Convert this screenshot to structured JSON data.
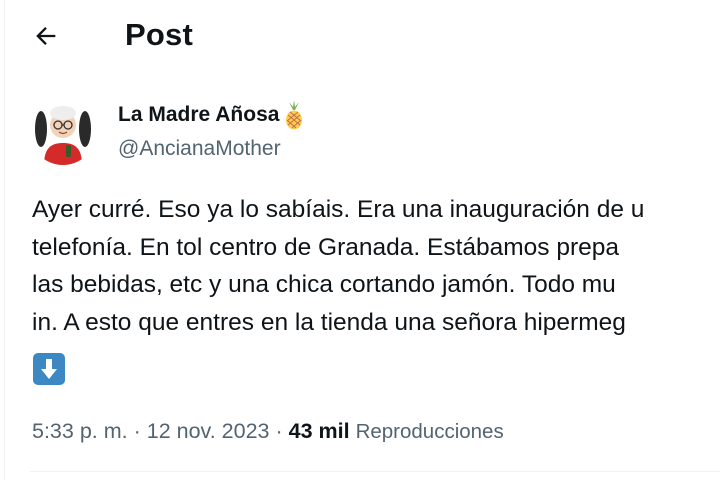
{
  "header": {
    "back_icon": "arrow-left-icon",
    "title": "Post"
  },
  "author": {
    "name": "La Madre Añosa",
    "name_emoji": "pineapple-icon",
    "handle": "@AncianaMother",
    "avatar": "cartoon-grandmother-avatar"
  },
  "tweet": {
    "lines": [
      "Ayer curré. Eso ya lo sabíais. Era una inauguración de u",
      "telefonía. En tol centro de Granada. Estábamos prepa",
      "las bebidas, etc y una chica cortando jamón. Todo mu",
      "in. A esto que entres en la tienda una señora hipermeg"
    ],
    "trailing_emoji": "down-arrow-button-icon"
  },
  "meta": {
    "time": "5:33 p. m.",
    "separator": "·",
    "date": "12 nov. 2023",
    "views_count": "43 mil",
    "views_label": "Reproducciones"
  },
  "colors": {
    "text_primary": "#0f1419",
    "text_secondary": "#536471",
    "divider": "#eff3f4",
    "emoji_blue": "#3b88c3"
  }
}
